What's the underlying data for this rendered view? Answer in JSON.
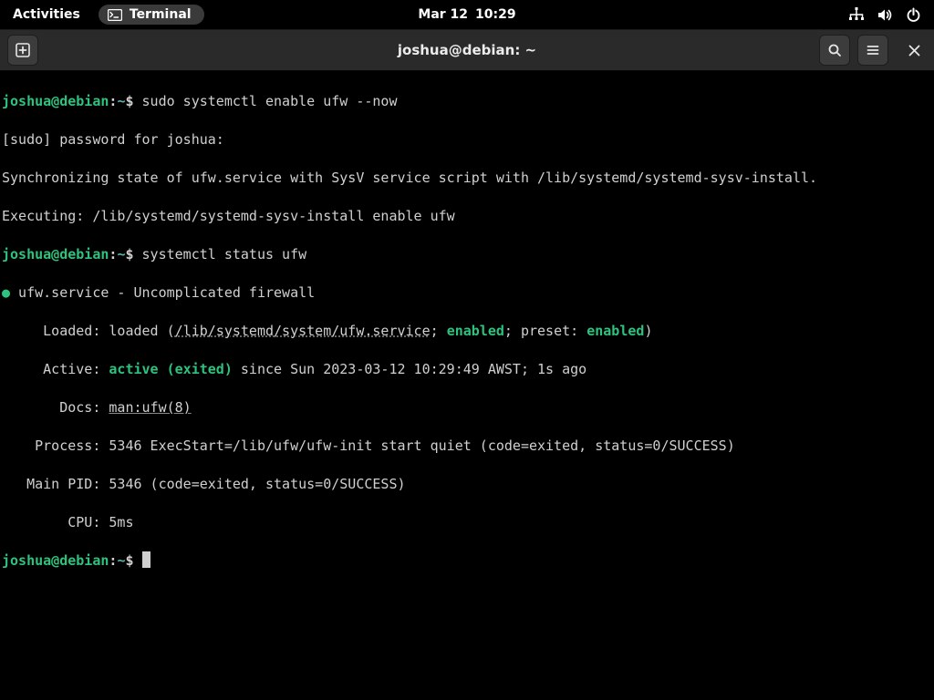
{
  "topbar": {
    "activities": "Activities",
    "app_name": "Terminal",
    "date": "Mar 12",
    "time": "10:29"
  },
  "titlebar": {
    "title": "joshua@debian: ~"
  },
  "prompt": {
    "user_host": "joshua@debian",
    "colon": ":",
    "path": "~",
    "symbol": "$"
  },
  "session": {
    "cmd1": "sudo systemctl enable ufw --now",
    "out1a": "[sudo] password for joshua:",
    "out1b": "Synchronizing state of ufw.service with SysV service script with /lib/systemd/systemd-sysv-install.",
    "out1c": "Executing: /lib/systemd/systemd-sysv-install enable ufw",
    "cmd2": "systemctl status ufw",
    "status": {
      "bullet": "●",
      "header": " ufw.service - Uncomplicated firewall",
      "loaded_pre": "     Loaded: loaded (",
      "loaded_path": "/lib/systemd/system/ufw.service",
      "loaded_mid1": "; ",
      "loaded_en1": "enabled",
      "loaded_mid2": "; preset: ",
      "loaded_en2": "enabled",
      "loaded_end": ")",
      "active_pre": "     Active: ",
      "active_state": "active (exited)",
      "active_post": " since Sun 2023-03-12 10:29:49 AWST; 1s ago",
      "docs_pre": "       Docs: ",
      "docs_link": "man:ufw(8)",
      "process": "    Process: 5346 ExecStart=/lib/ufw/ufw-init start quiet (code=exited, status=0/SUCCESS)",
      "mainpid": "   Main PID: 5346 (code=exited, status=0/SUCCESS)",
      "cpu": "        CPU: 5ms"
    }
  }
}
